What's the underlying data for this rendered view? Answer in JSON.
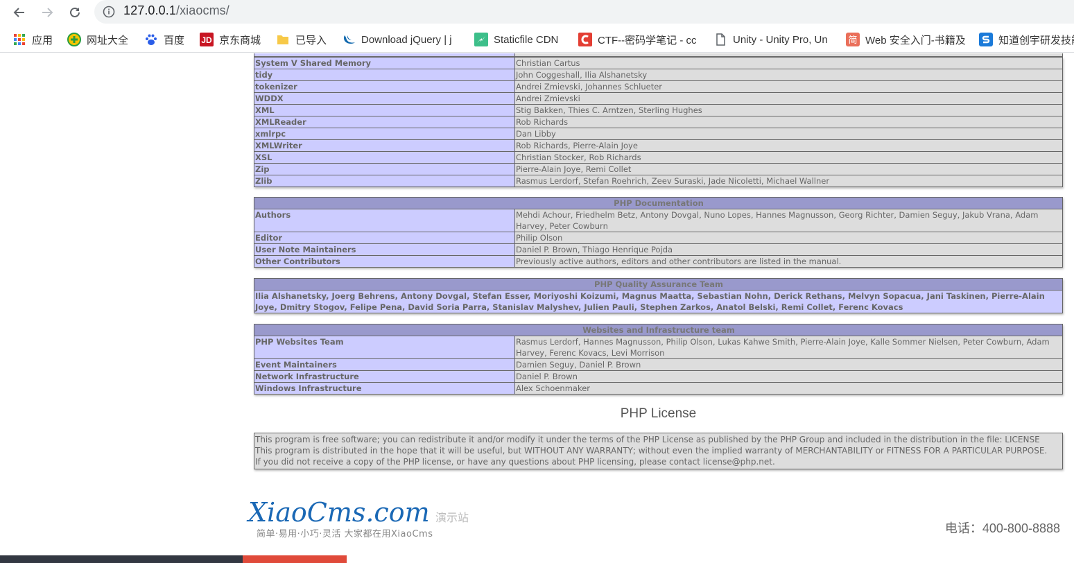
{
  "browser": {
    "url_host": "127.0.0.1",
    "url_path": "/xiaocms/",
    "bookmarks": [
      {
        "label": "应用",
        "icon": "apps-grid-icon"
      },
      {
        "label": "网址大全",
        "icon": "hao123-icon"
      },
      {
        "label": "百度",
        "icon": "baidu-paw-icon"
      },
      {
        "label": "京东商城",
        "icon": "jd-icon"
      },
      {
        "label": "已导入",
        "icon": "folder-icon"
      },
      {
        "label": "Download jQuery | j",
        "icon": "jquery-icon"
      },
      {
        "label": "Staticfile CDN",
        "icon": "staticfile-icon"
      },
      {
        "label": "CTF--密码学笔记 - cc",
        "icon": "csdn-icon"
      },
      {
        "label": "Unity - Unity Pro, Un",
        "icon": "page-icon"
      },
      {
        "label": "Web 安全入门-书籍及",
        "icon": "jianshu-icon"
      },
      {
        "label": "知道创宇研发技能",
        "icon": "knownsec-icon"
      }
    ]
  },
  "credits_modules": {
    "rows": [
      {
        "name": "System V Shared Memory",
        "authors": "Christian Cartus"
      },
      {
        "name": "tidy",
        "authors": "John Coggeshall, Ilia Alshanetsky"
      },
      {
        "name": "tokenizer",
        "authors": "Andrei Zmievski, Johannes Schlueter"
      },
      {
        "name": "WDDX",
        "authors": "Andrei Zmievski"
      },
      {
        "name": "XML",
        "authors": "Stig Bakken, Thies C. Arntzen, Sterling Hughes"
      },
      {
        "name": "XMLReader",
        "authors": "Rob Richards"
      },
      {
        "name": "xmlrpc",
        "authors": "Dan Libby"
      },
      {
        "name": "XMLWriter",
        "authors": "Rob Richards, Pierre-Alain Joye"
      },
      {
        "name": "XSL",
        "authors": "Christian Stocker, Rob Richards"
      },
      {
        "name": "Zip",
        "authors": "Pierre-Alain Joye, Remi Collet"
      },
      {
        "name": "Zlib",
        "authors": "Rasmus Lerdorf, Stefan Roehrich, Zeev Suraski, Jade Nicoletti, Michael Wallner"
      }
    ]
  },
  "documentation": {
    "header": "PHP Documentation",
    "rows": [
      {
        "name": "Authors",
        "value": "Mehdi Achour, Friedhelm Betz, Antony Dovgal, Nuno Lopes, Hannes Magnusson, Georg Richter, Damien Seguy, Jakub Vrana, Adam Harvey, Peter Cowburn"
      },
      {
        "name": "Editor",
        "value": "Philip Olson"
      },
      {
        "name": "User Note Maintainers",
        "value": "Daniel P. Brown, Thiago Henrique Pojda"
      },
      {
        "name": "Other Contributors",
        "value": "Previously active authors, editors and other contributors are listed in the manual."
      }
    ]
  },
  "qa": {
    "header": "PHP Quality Assurance Team",
    "members": "Ilia Alshanetsky, Joerg Behrens, Antony Dovgal, Stefan Esser, Moriyoshi Koizumi, Magnus Maatta, Sebastian Nohn, Derick Rethans, Melvyn Sopacua, Jani Taskinen, Pierre-Alain Joye, Dmitry Stogov, Felipe Pena, David Soria Parra, Stanislav Malyshev, Julien Pauli, Stephen Zarkos, Anatol Belski, Remi Collet, Ferenc Kovacs"
  },
  "websites": {
    "header": "Websites and Infrastructure team",
    "rows": [
      {
        "name": "PHP Websites Team",
        "value": "Rasmus Lerdorf, Hannes Magnusson, Philip Olson, Lukas Kahwe Smith, Pierre-Alain Joye, Kalle Sommer Nielsen, Peter Cowburn, Adam Harvey, Ferenc Kovacs, Levi Morrison"
      },
      {
        "name": "Event Maintainers",
        "value": "Damien Seguy, Daniel P. Brown"
      },
      {
        "name": "Network Infrastructure",
        "value": "Daniel P. Brown"
      },
      {
        "name": "Windows Infrastructure",
        "value": "Alex Schoenmaker"
      }
    ]
  },
  "license": {
    "title": "PHP License",
    "lines": [
      "This program is free software; you can redistribute it and/or modify it under the terms of the PHP License as published by the PHP Group and included in the distribution in the file: LICENSE",
      "This program is distributed in the hope that it will be useful, but WITHOUT ANY WARRANTY; without even the implied warranty of MERCHANTABILITY or FITNESS FOR A PARTICULAR PURPOSE.",
      "If you did not receive a copy of the PHP license, or have any questions about PHP licensing, please contact license@php.net."
    ]
  },
  "footer": {
    "brand": "XiaoCms.com",
    "demo": "演示站",
    "slogan": "简单·易用·小巧·灵活 大家都在用XiaoCms",
    "phone": "电话：400-800-8888"
  },
  "colors": {
    "module_name_bg": "#ccccff",
    "value_bg": "#dddddd",
    "header_bg": "#9999cc",
    "brand_blue": "#1a68b5"
  }
}
